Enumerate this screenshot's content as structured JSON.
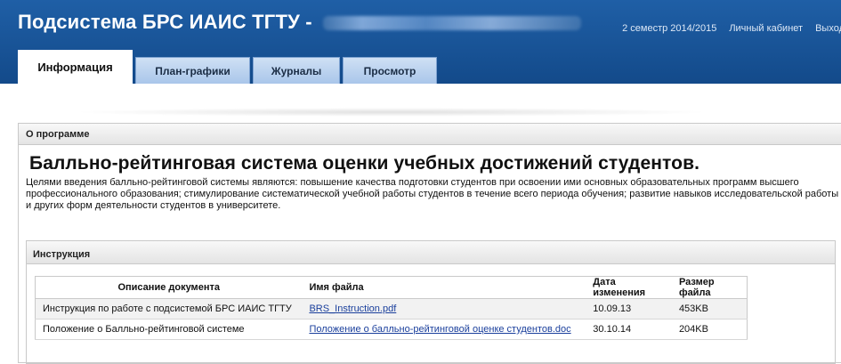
{
  "header": {
    "title": "Подсистема БРС ИАИС ТГТУ -",
    "user_name_blurred": "Глинкин Евгений Иванович",
    "links": [
      "2 семестр 2014/2015",
      "Личный кабинет",
      "Выход"
    ]
  },
  "tabs": [
    {
      "label": "Информация",
      "active": true
    },
    {
      "label": "План-графики",
      "active": false
    },
    {
      "label": "Журналы",
      "active": false
    },
    {
      "label": "Просмотр",
      "active": false
    }
  ],
  "about": {
    "panel_title": "О программе",
    "heading": "Балльно-рейтинговая система оценки учебных достижений студентов.",
    "description": "Целями введения балльно-рейтинговой системы являются: повышение качества подготовки студентов при освоении ими основных образовательных программ высшего профессионального образования; стимулирование систематической учебной работы студентов в течение всего периода обучения; развитие навыков исследовательской работы и других форм деятельности студентов в университете."
  },
  "instructions": {
    "panel_title": "Инструкция",
    "columns": [
      "Описание документа",
      "Имя файла",
      "Дата изменения",
      "Размер файла"
    ],
    "rows": [
      {
        "description": "Инструкция по работе с подсистемой БРС ИАИС ТГТУ",
        "file": "BRS_Instruction.pdf",
        "date": "10.09.13",
        "size": "453KB"
      },
      {
        "description": "Положение о Балльно-рейтинговой системе",
        "file": "Положение о балльно-рейтинговой оценке студентов.doc",
        "date": "30.10.14",
        "size": "204KB"
      }
    ]
  },
  "colors": {
    "header_bg": "#1a559a",
    "tab_bg": "#b9d1ee",
    "link": "#1a3f9c"
  }
}
